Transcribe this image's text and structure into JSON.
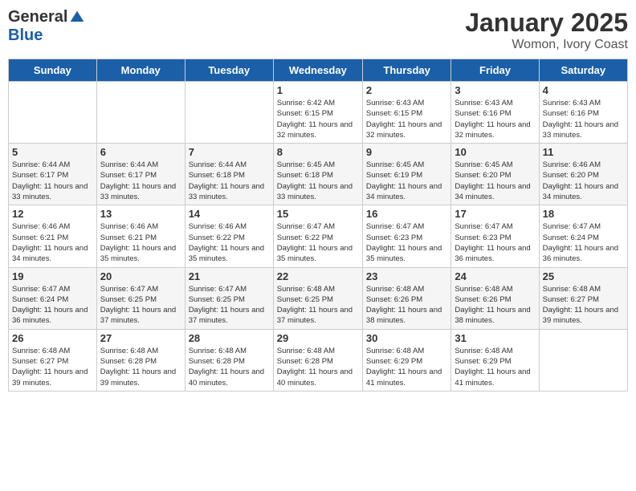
{
  "logo": {
    "general": "General",
    "blue": "Blue"
  },
  "header": {
    "title": "January 2025",
    "subtitle": "Womon, Ivory Coast"
  },
  "days_of_week": [
    "Sunday",
    "Monday",
    "Tuesday",
    "Wednesday",
    "Thursday",
    "Friday",
    "Saturday"
  ],
  "weeks": [
    [
      {
        "day": "",
        "info": ""
      },
      {
        "day": "",
        "info": ""
      },
      {
        "day": "",
        "info": ""
      },
      {
        "day": "1",
        "info": "Sunrise: 6:42 AM\nSunset: 6:15 PM\nDaylight: 11 hours\nand 32 minutes."
      },
      {
        "day": "2",
        "info": "Sunrise: 6:43 AM\nSunset: 6:15 PM\nDaylight: 11 hours\nand 32 minutes."
      },
      {
        "day": "3",
        "info": "Sunrise: 6:43 AM\nSunset: 6:16 PM\nDaylight: 11 hours\nand 32 minutes."
      },
      {
        "day": "4",
        "info": "Sunrise: 6:43 AM\nSunset: 6:16 PM\nDaylight: 11 hours\nand 33 minutes."
      }
    ],
    [
      {
        "day": "5",
        "info": "Sunrise: 6:44 AM\nSunset: 6:17 PM\nDaylight: 11 hours\nand 33 minutes."
      },
      {
        "day": "6",
        "info": "Sunrise: 6:44 AM\nSunset: 6:17 PM\nDaylight: 11 hours\nand 33 minutes."
      },
      {
        "day": "7",
        "info": "Sunrise: 6:44 AM\nSunset: 6:18 PM\nDaylight: 11 hours\nand 33 minutes."
      },
      {
        "day": "8",
        "info": "Sunrise: 6:45 AM\nSunset: 6:18 PM\nDaylight: 11 hours\nand 33 minutes."
      },
      {
        "day": "9",
        "info": "Sunrise: 6:45 AM\nSunset: 6:19 PM\nDaylight: 11 hours\nand 34 minutes."
      },
      {
        "day": "10",
        "info": "Sunrise: 6:45 AM\nSunset: 6:20 PM\nDaylight: 11 hours\nand 34 minutes."
      },
      {
        "day": "11",
        "info": "Sunrise: 6:46 AM\nSunset: 6:20 PM\nDaylight: 11 hours\nand 34 minutes."
      }
    ],
    [
      {
        "day": "12",
        "info": "Sunrise: 6:46 AM\nSunset: 6:21 PM\nDaylight: 11 hours\nand 34 minutes."
      },
      {
        "day": "13",
        "info": "Sunrise: 6:46 AM\nSunset: 6:21 PM\nDaylight: 11 hours\nand 35 minutes."
      },
      {
        "day": "14",
        "info": "Sunrise: 6:46 AM\nSunset: 6:22 PM\nDaylight: 11 hours\nand 35 minutes."
      },
      {
        "day": "15",
        "info": "Sunrise: 6:47 AM\nSunset: 6:22 PM\nDaylight: 11 hours\nand 35 minutes."
      },
      {
        "day": "16",
        "info": "Sunrise: 6:47 AM\nSunset: 6:23 PM\nDaylight: 11 hours\nand 35 minutes."
      },
      {
        "day": "17",
        "info": "Sunrise: 6:47 AM\nSunset: 6:23 PM\nDaylight: 11 hours\nand 36 minutes."
      },
      {
        "day": "18",
        "info": "Sunrise: 6:47 AM\nSunset: 6:24 PM\nDaylight: 11 hours\nand 36 minutes."
      }
    ],
    [
      {
        "day": "19",
        "info": "Sunrise: 6:47 AM\nSunset: 6:24 PM\nDaylight: 11 hours\nand 36 minutes."
      },
      {
        "day": "20",
        "info": "Sunrise: 6:47 AM\nSunset: 6:25 PM\nDaylight: 11 hours\nand 37 minutes."
      },
      {
        "day": "21",
        "info": "Sunrise: 6:47 AM\nSunset: 6:25 PM\nDaylight: 11 hours\nand 37 minutes."
      },
      {
        "day": "22",
        "info": "Sunrise: 6:48 AM\nSunset: 6:25 PM\nDaylight: 11 hours\nand 37 minutes."
      },
      {
        "day": "23",
        "info": "Sunrise: 6:48 AM\nSunset: 6:26 PM\nDaylight: 11 hours\nand 38 minutes."
      },
      {
        "day": "24",
        "info": "Sunrise: 6:48 AM\nSunset: 6:26 PM\nDaylight: 11 hours\nand 38 minutes."
      },
      {
        "day": "25",
        "info": "Sunrise: 6:48 AM\nSunset: 6:27 PM\nDaylight: 11 hours\nand 39 minutes."
      }
    ],
    [
      {
        "day": "26",
        "info": "Sunrise: 6:48 AM\nSunset: 6:27 PM\nDaylight: 11 hours\nand 39 minutes."
      },
      {
        "day": "27",
        "info": "Sunrise: 6:48 AM\nSunset: 6:28 PM\nDaylight: 11 hours\nand 39 minutes."
      },
      {
        "day": "28",
        "info": "Sunrise: 6:48 AM\nSunset: 6:28 PM\nDaylight: 11 hours\nand 40 minutes."
      },
      {
        "day": "29",
        "info": "Sunrise: 6:48 AM\nSunset: 6:28 PM\nDaylight: 11 hours\nand 40 minutes."
      },
      {
        "day": "30",
        "info": "Sunrise: 6:48 AM\nSunset: 6:29 PM\nDaylight: 11 hours\nand 41 minutes."
      },
      {
        "day": "31",
        "info": "Sunrise: 6:48 AM\nSunset: 6:29 PM\nDaylight: 11 hours\nand 41 minutes."
      },
      {
        "day": "",
        "info": ""
      }
    ]
  ]
}
